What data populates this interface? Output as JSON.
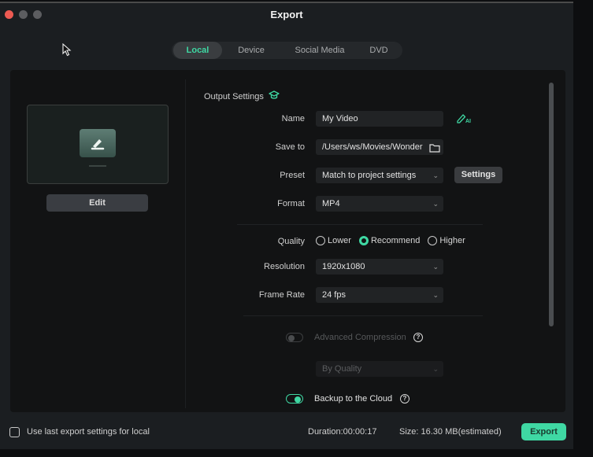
{
  "window": {
    "title": "Export"
  },
  "tabs": [
    {
      "label": "Local",
      "active": true
    },
    {
      "label": "Device",
      "active": false
    },
    {
      "label": "Social Media",
      "active": false
    },
    {
      "label": "DVD",
      "active": false
    }
  ],
  "preview": {
    "edit_label": "Edit"
  },
  "output_settings": {
    "title": "Output Settings",
    "name": {
      "label": "Name",
      "value": "My Video"
    },
    "save_to": {
      "label": "Save to",
      "value": "/Users/ws/Movies/Wonder"
    },
    "preset": {
      "label": "Preset",
      "value": "Match to project settings",
      "settings_label": "Settings"
    },
    "format": {
      "label": "Format",
      "value": "MP4"
    },
    "quality": {
      "label": "Quality",
      "options": [
        "Lower",
        "Recommend",
        "Higher"
      ],
      "selected": "Recommend"
    },
    "resolution": {
      "label": "Resolution",
      "value": "1920x1080"
    },
    "frame_rate": {
      "label": "Frame Rate",
      "value": "24 fps"
    },
    "advanced_compression": {
      "label": "Advanced Compression",
      "enabled": false,
      "mode": "By Quality"
    },
    "backup_cloud": {
      "label": "Backup to the Cloud",
      "enabled": true
    }
  },
  "footer": {
    "use_last_label": "Use last export settings for local",
    "use_last_checked": false,
    "duration": "Duration:00:00:17",
    "size": "Size: 16.30 MB(estimated)",
    "export_label": "Export"
  },
  "colors": {
    "accent": "#3fd8a3",
    "close": "#ed5a52"
  },
  "help_glyph": "?",
  "chevron_glyph": "⌄"
}
